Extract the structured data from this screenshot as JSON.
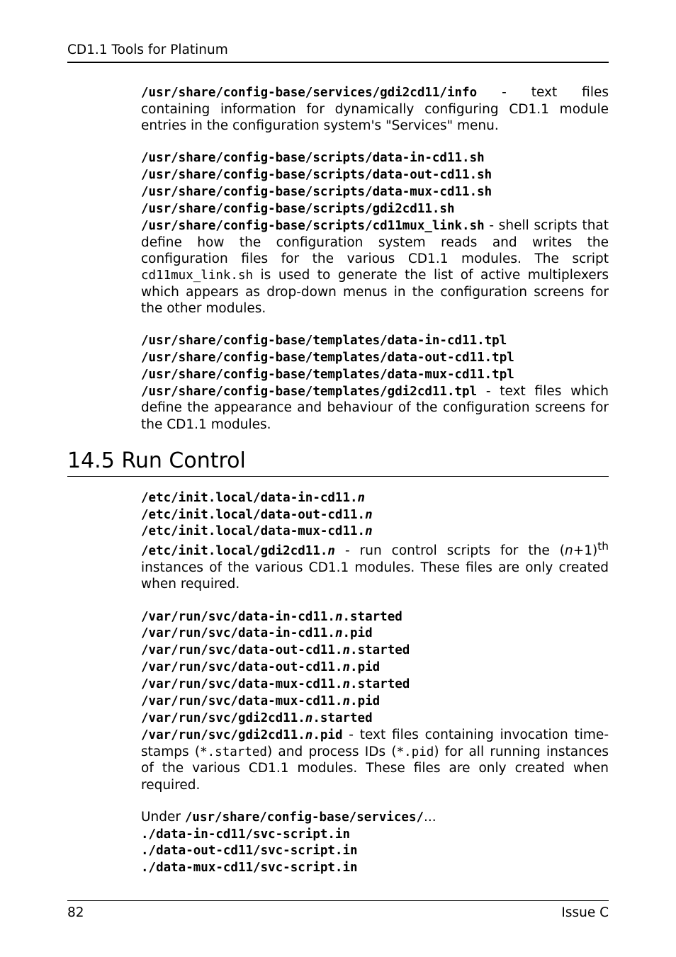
{
  "header": {
    "title": "CD1.1 Tools for Platinum"
  },
  "p1": {
    "path": "/usr/share/config-base/services/gdi2cd11/info",
    "sep": " - ",
    "text": "text files containing information for dynamically configuring CD1.1 module entries in the configuration system's  \"Services\" menu."
  },
  "p2": {
    "l1": "/usr/share/config-base/scripts/data-in-cd11.sh",
    "l2": "/usr/share/config-base/scripts/data-out-cd11.sh",
    "l3": "/usr/share/config-base/scripts/data-mux-cd11.sh",
    "l4": "/usr/share/config-base/scripts/gdi2cd11.sh",
    "l5": "/usr/share/config-base/scripts/cd11mux_link.sh",
    "sep": " - ",
    "text1": "shell scripts that define how the configuration system reads and writes the configuration files for the various CD1.1 modules.  The script ",
    "code": "cd11mux_link.sh",
    "text2": " is used to generate the list of active multiplexers which appears as drop-down menus in the configuration screens for the other modules."
  },
  "p3": {
    "l1": "/usr/share/config-base/templates/data-in-cd11.tpl",
    "l2": "/usr/share/config-base/templates/data-out-cd11.tpl",
    "l3": "/usr/share/config-base/templates/data-mux-cd11.tpl",
    "l4": "/usr/share/config-base/templates/gdi2cd11.tpl",
    "sep": " - ",
    "text": "text files which define the appearance and behaviour of the configuration screens for the CD1.1 modules."
  },
  "section": {
    "title": "14.5 Run Control"
  },
  "p4": {
    "l1a": "/etc/init.local/data-in-cd11.",
    "l1b": "n",
    "l2a": "/etc/init.local/data-out-cd11.",
    "l2b": "n",
    "l3a": "/etc/init.local/data-mux-cd11.",
    "l3b": "n",
    "l4a": "/etc/init.local/gdi2cd11.",
    "l4b": "n",
    "sep": " - ",
    "text1": "run control scripts for the (",
    "nvar": "n",
    "text2": "+1)",
    "sup": "th",
    "text3": " instances of the various CD1.1 modules.  These files are only created when required."
  },
  "p5": {
    "l1a": "/var/run/svc/data-in-cd11.",
    "n": "n",
    "l1c": ".started",
    "l2a": "/var/run/svc/data-in-cd11.",
    "l2c": ".pid",
    "l3a": "/var/run/svc/data-out-cd11.",
    "l3c": ".started",
    "l4a": "/var/run/svc/data-out-cd11.",
    "l4c": ".pid",
    "l5a": "/var/run/svc/data-mux-cd11.",
    "l5c": ".started",
    "l6a": "/var/run/svc/data-mux-cd11.",
    "l6c": ".pid",
    "l7a": "/var/run/svc/gdi2cd11.",
    "l7c": ".started",
    "l8a": "/var/run/svc/gdi2cd11.",
    "l8c": ".pid",
    "sep": " - ",
    "text1": "text files containing invocation time-stamps (",
    "code1": "*.started",
    "text2": ") and process IDs (",
    "code2": "*.pid",
    "text3": ") for all running instances of the various CD1.1 modules.  These files are only created when required."
  },
  "p6": {
    "intro1": "Under ",
    "intropath": "/usr/share/config-base/services/",
    "intro2": "...",
    "l1": "./data-in-cd11/svc-script.in",
    "l2": "./data-out-cd11/svc-script.in",
    "l3": "./data-mux-cd11/svc-script.in"
  },
  "footer": {
    "left": "82",
    "right": "Issue C"
  }
}
